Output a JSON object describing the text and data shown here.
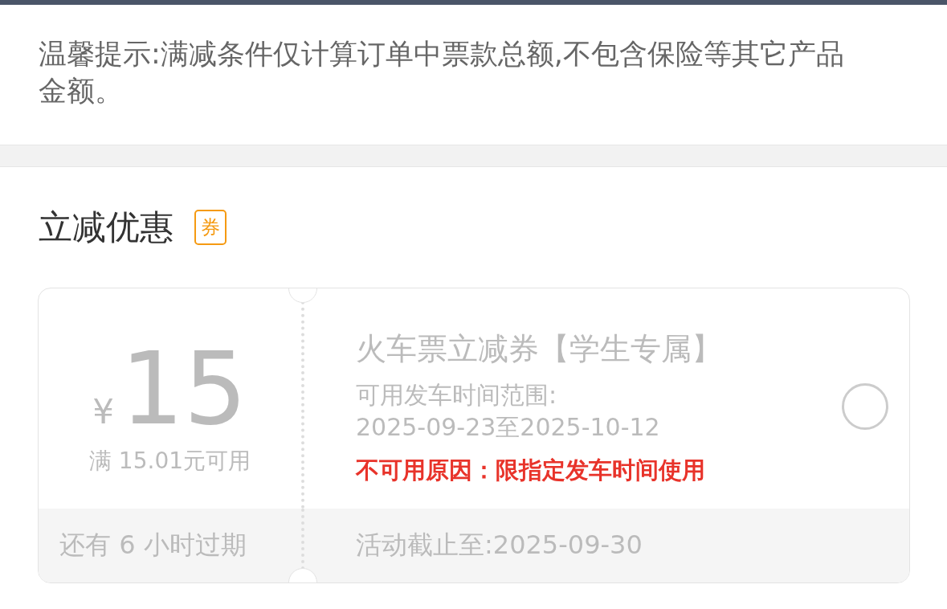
{
  "notice": "温馨提示:满减条件仅计算订单中票款总额,不包含保险等其它产品金额。",
  "section": {
    "title": "立减优惠",
    "badge": "券"
  },
  "coupon": {
    "currency": "¥",
    "amount": "15",
    "condition": "满 15.01元可用",
    "expiry": "还有 6 小时过期",
    "title": "火车票立减券【学生专属】",
    "range_label": "可用发车时间范围:",
    "range": "2025-09-23至2025-10-12",
    "reason": "不可用原因：限指定发车时间使用",
    "deadline": "活动截止至:2025-09-30",
    "selected": false
  }
}
